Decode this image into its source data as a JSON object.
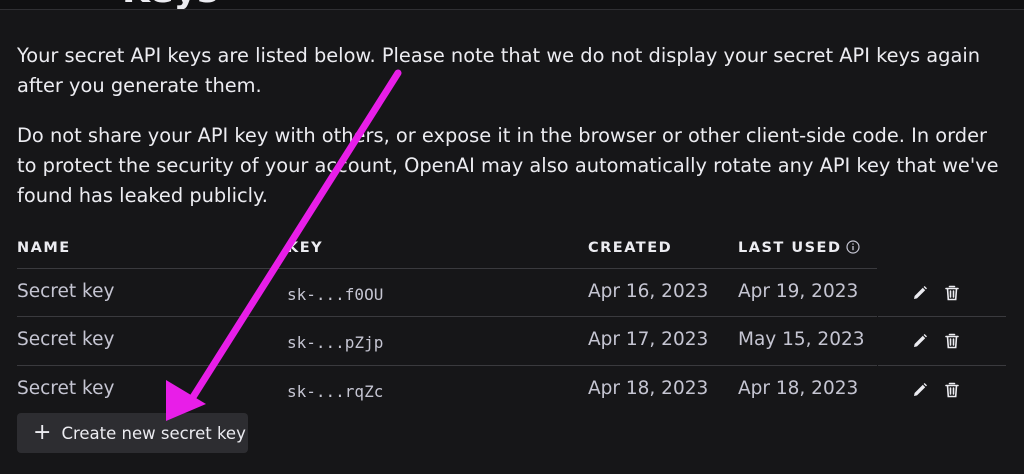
{
  "header": {
    "title_fragment": "Keys"
  },
  "intro": {
    "paragraph_1": "Your secret API keys are listed below. Please note that we do not display your secret API keys again after you generate them.",
    "paragraph_2": "Do not share your API key with others, or expose it in the browser or other client-side code. In order to protect the security of your account, OpenAI may also automatically rotate any API key that we've found has leaked publicly."
  },
  "table": {
    "columns": {
      "name": "NAME",
      "key": "KEY",
      "created": "CREATED",
      "last_used": "LAST USED"
    },
    "rows": [
      {
        "name": "Secret key",
        "key": "sk-...f0OU",
        "created": "Apr 16, 2023",
        "last_used": "Apr 19, 2023"
      },
      {
        "name": "Secret key",
        "key": "sk-...pZjp",
        "created": "Apr 17, 2023",
        "last_used": "May 15, 2023"
      },
      {
        "name": "Secret key",
        "key": "sk-...rqZc",
        "created": "Apr 18, 2023",
        "last_used": "Apr 18, 2023"
      }
    ]
  },
  "actions": {
    "create_label": "Create new secret key"
  },
  "icons": {
    "edit": "pencil-icon",
    "delete": "trash-icon",
    "info": "info-icon",
    "create": "plus-icon"
  },
  "colors": {
    "background": "#161618",
    "annotation_arrow": "#e81ee8",
    "button_bg": "#2d2d31"
  }
}
